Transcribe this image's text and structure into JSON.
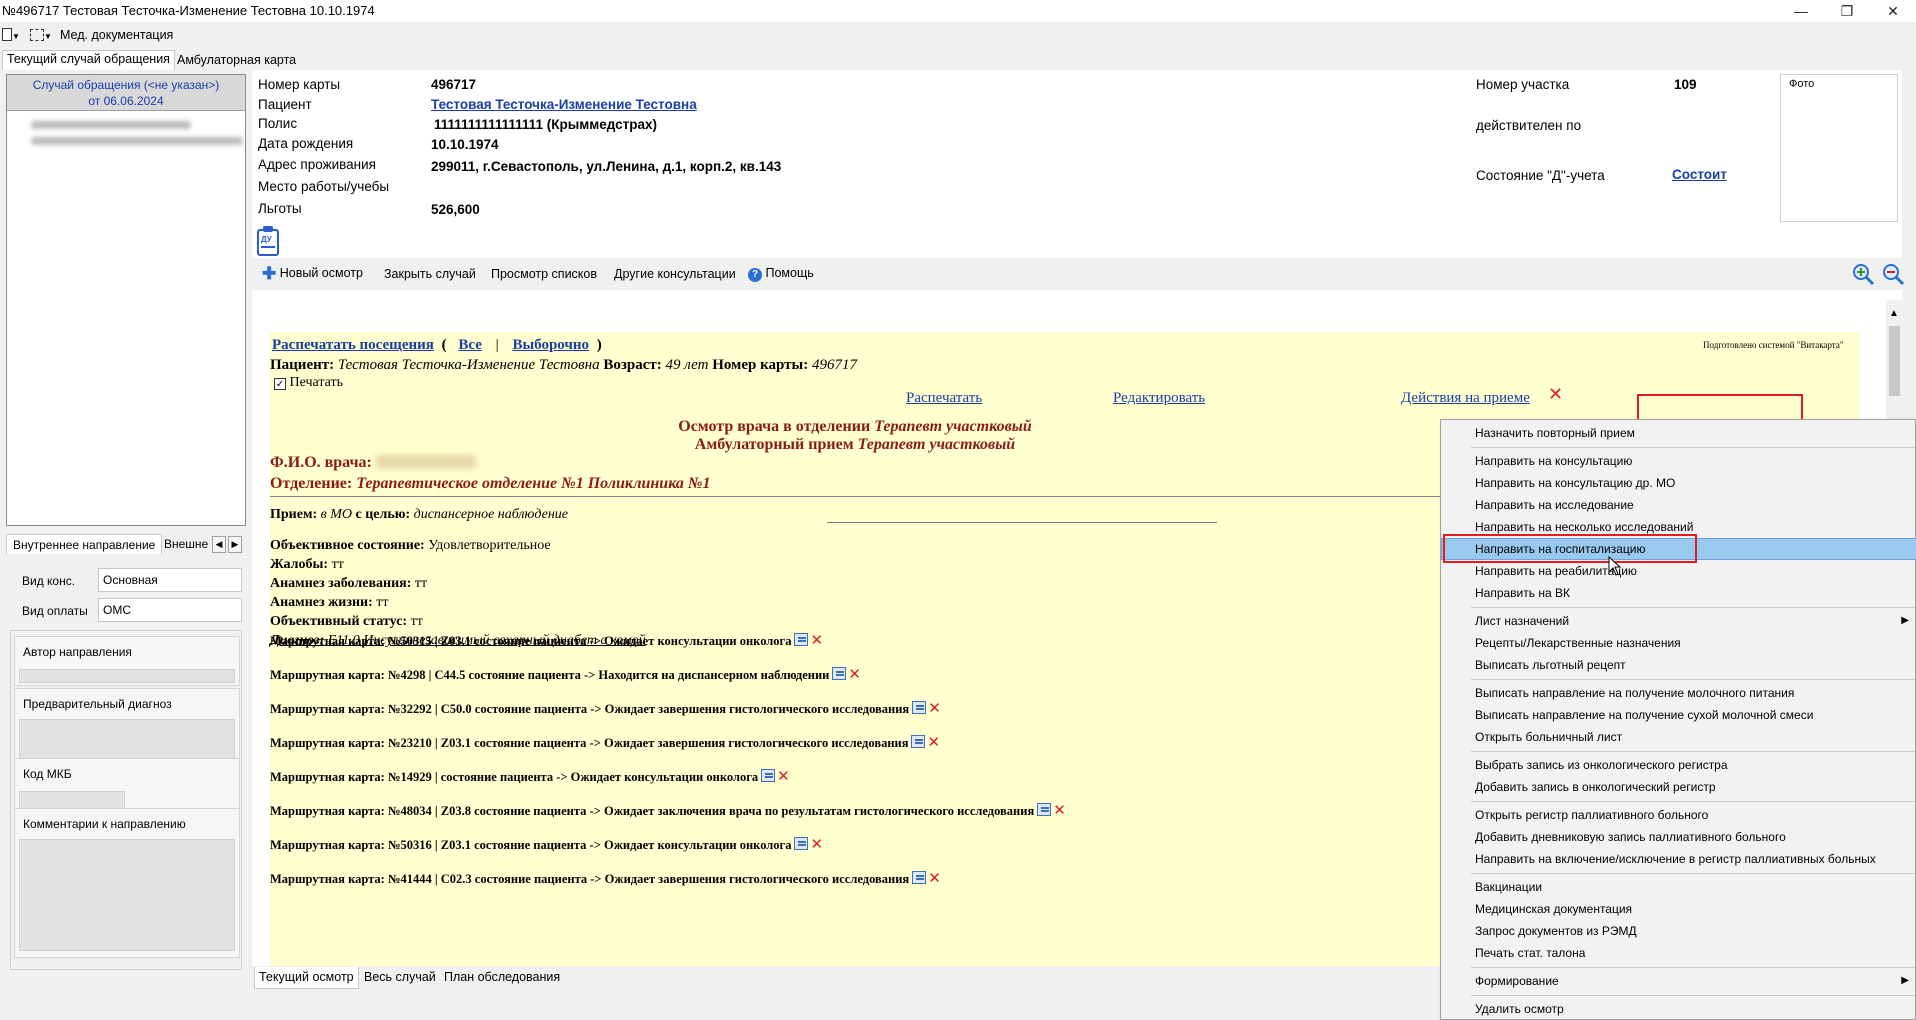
{
  "window": {
    "title": "№496717 Тестовая Тесточка-Изменение Тестовна 10.10.1974"
  },
  "toolbar": {
    "med_docs": "Мед. документация"
  },
  "case_tabs": [
    "Текущий случай обращения",
    "Амбулаторная карта"
  ],
  "case_header": {
    "line1": "Случай обращения (<не указан>)",
    "line2": "от 06.06.2024"
  },
  "left_tabs": {
    "internal": "Внутреннее направление",
    "external": "Внешне"
  },
  "form": {
    "vid_kons_label": "Вид конс.",
    "vid_kons_value": "Основная",
    "vid_oplaty_label": "Вид оплаты",
    "vid_oplaty_value": "ОМС",
    "author_label": "Автор направления",
    "prelim_diag_label": "Предварительный диагноз",
    "mkb_label": "Код МКБ",
    "comments_label": "Комментарии к направлению"
  },
  "patient": {
    "card_no_label": "Номер карты",
    "card_no": "496717",
    "patient_label": "Пациент",
    "patient_name": "Тестовая Тесточка-Изменение Тестовна",
    "policy_label": "Полис",
    "policy": "1111111111111111 (Крыммедстрах)",
    "dob_label": "Дата рождения",
    "dob": "10.10.1974",
    "address_label": "Адрес проживания",
    "address": "299011, г.Севастополь, ул.Ленина, д.1, корп.2, кв.143",
    "work_label": "Место работы/учебы",
    "benefits_label": "Льготы",
    "benefits": "526,600",
    "district_label": "Номер участка",
    "district": "109",
    "valid_label": "действителен по",
    "d_status_label": "Состояние \"Д\"-учета",
    "d_status": "Состоит",
    "photo_label": "Фото",
    "badge_icon_text": "ДУ"
  },
  "actions": {
    "new_exam": "Новый осмотр",
    "close_case": "Закрыть случай",
    "view_lists": "Просмотр списков",
    "other_consult": "Другие консультации",
    "help": "Помощь"
  },
  "report": {
    "print_visits": "Распечатать посещения",
    "open_paren": "(",
    "all": "Все",
    "pipe": "|",
    "selective": "Выборочно",
    "close_paren": ")",
    "prepared_by": "Подготовлено системой \"Витакарта\"",
    "patient_label": "Пациент:",
    "patient_name": "Тестовая Тесточка-Изменение Тестовна",
    "age_label": "Возраст:",
    "age": "49 лет",
    "card_label": "Номер карты:",
    "card": "496717",
    "print_checkbox": "Печатать",
    "print_link": "Распечатать",
    "edit_link": "Редактировать",
    "actions_link": "Действия на приеме",
    "heading1_prefix": "Осмотр врача в отделении",
    "heading1_dept": "Терапевт участковый",
    "heading2_prefix": "Амбулаторный прием",
    "heading2_dept": "Терапевт участковый",
    "doctor_label": "Ф.И.О. врача:",
    "department_label": "Отделение:",
    "department": "Терапевтическое отделение №1 Поликлиника №1",
    "reception_label": "Прием:",
    "reception_value_1": "в МО",
    "reception_mid": "с целью:",
    "reception_value_2": "диспансерное наблюдение",
    "objective_label": "Объективное состояние:",
    "objective_value": "Удовлетворительное",
    "complaints_label": "Жалобы:",
    "complaints_value": "тт",
    "anamnesis_disease_label": "Анамнез заболевания:",
    "anamnesis_disease_value": "тт",
    "anamnesis_life_label": "Анамнез жизни:",
    "anamnesis_life_value": "тт",
    "objective_status_label": "Объективный статус:",
    "objective_status_value": "тт",
    "diagnosis_label": "Диагноз:",
    "diagnosis_value": "E11.0 Инсулиннезависимый сахарный диабет с комой",
    "routes": [
      "Маршрутная карта: №50315 | Z03.1 состояние пациента -> Ожидает консультации онколога",
      "Маршрутная карта: №4298 | C44.5 состояние пациента -> Находится на диспансерном наблюдении",
      "Маршрутная карта: №32292 | C50.0 состояние пациента -> Ожидает завершения гистологического исследования",
      "Маршрутная карта: №23210 | Z03.1 состояние пациента -> Ожидает завершения гистологического исследования",
      "Маршрутная карта: №14929 | состояние пациента -> Ожидает консультации онколога",
      "Маршрутная карта: №48034 | Z03.8 состояние пациента -> Ожидает заключения врача по результатам гистологического исследования",
      "Маршрутная карта: №50316 | Z03.1 состояние пациента -> Ожидает консультации онколога",
      "Маршрутная карта: №41444 | C02.3 состояние пациента -> Ожидает завершения гистологического исследования"
    ]
  },
  "bottom_tabs": [
    "Текущий осмотр",
    "Весь случай",
    "План обследования"
  ],
  "context_menu": [
    "Назначить повторный прием",
    "Направить на консультацию",
    "Направить на консультацию др. МО",
    "Направить на исследование",
    "Направить на несколько исследований",
    "Направить на госпитализацию",
    "Направить на реабилитацию",
    "Направить на ВК",
    "Лист назначений",
    "Рецепты/Лекарственные назначения",
    "Выписать льготный рецепт",
    "Выписать направление на получение молочного питания",
    "Выписать направление на получение сухой молочной смеси",
    "Открыть больничный лист",
    "Выбрать запись из онкологического регистра",
    "Добавить запись в онкологический регистр",
    "Открыть регистр паллиативного больного",
    "Добавить дневниковую запись паллиативного больного",
    "Направить на включение/исключение в регистр паллиативных больных",
    "Вакцинации",
    "Медицинская документация",
    "Запрос документов из РЭМД",
    "Печать стат. талона",
    "Формирование",
    "Удалить осмотр"
  ],
  "colors": {
    "link": "#1a3ea8",
    "report_bg": "#ffffd0",
    "heading_red": "#8b1a1a",
    "highlight": "#99c9ef",
    "annotation_red": "#e01c1c"
  }
}
